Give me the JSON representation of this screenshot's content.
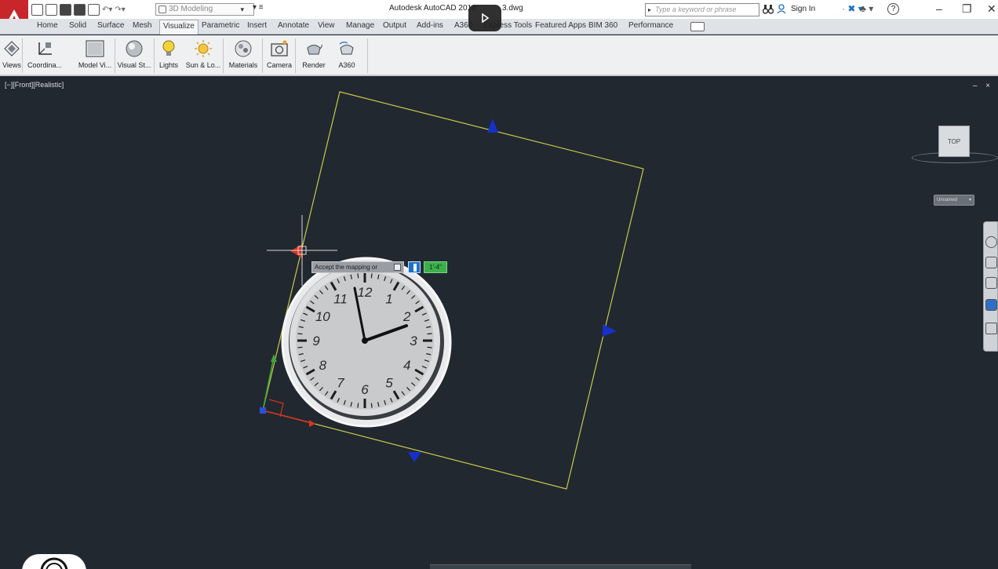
{
  "titlebar": {
    "workspace": "3D Modeling",
    "doc_title": "Autodesk AutoCAD 2018",
    "doc_suffix": "3.dwg",
    "search_placeholder": "Type a keyword or phrase",
    "sign_in": "Sign In"
  },
  "ribbon": {
    "tabs": [
      "Home",
      "Solid",
      "Surface",
      "Mesh",
      "Visualize",
      "Parametric",
      "Insert",
      "Annotate",
      "View",
      "Manage",
      "Output",
      "Add-ins",
      "A360",
      "Express Tools",
      "Featured Apps",
      "BIM 360",
      "Performance"
    ],
    "active_tab": "Visualize",
    "tools": [
      "Views",
      "Coordina...",
      "Model Vi...",
      "Visual St...",
      "Lights",
      "Sun & Lo...",
      "Materials",
      "Camera",
      "Render",
      "A360"
    ]
  },
  "viewport": {
    "label": "[−][Front][Realistic]",
    "controls": "– ×"
  },
  "viewcube": {
    "face": "TOP",
    "wcs": "Unnamed"
  },
  "dynamic_input": {
    "prompt": "Accept the mapping or",
    "value": "1'-4\""
  },
  "clock": {
    "numerals": [
      "12",
      "1",
      "2",
      "3",
      "4",
      "5",
      "6",
      "7",
      "8",
      "9",
      "10",
      "11"
    ],
    "hour_hand": "10:10"
  },
  "colors": {
    "background": "#212830",
    "gizmo_frame": "#c9c84a",
    "grip_blue": "#1630c8",
    "grip_red": "#d8331f",
    "axis_green": "#3fa53c"
  }
}
